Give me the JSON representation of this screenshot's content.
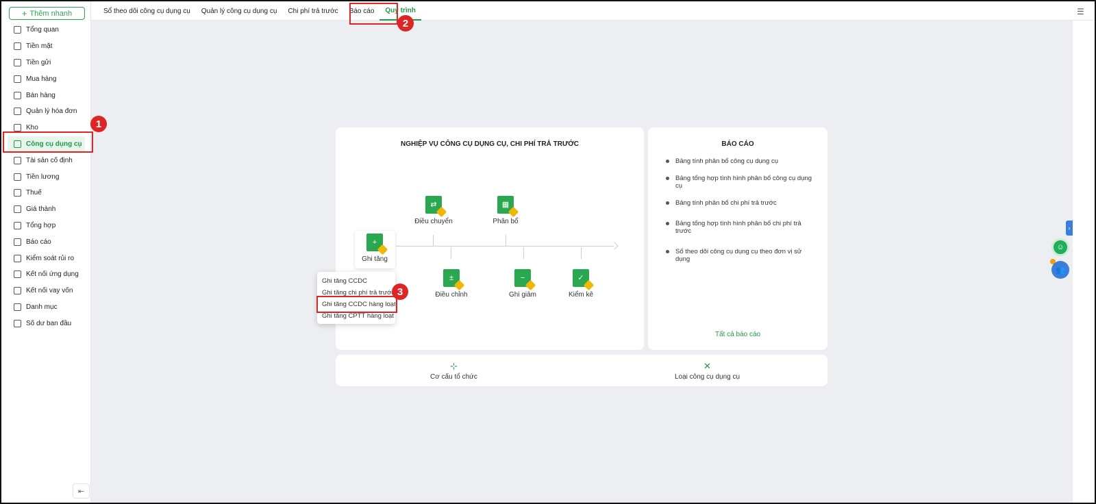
{
  "sidebar": {
    "add_button": "Thêm nhanh",
    "items": [
      {
        "label": "Tổng quan"
      },
      {
        "label": "Tiền mặt"
      },
      {
        "label": "Tiền gửi"
      },
      {
        "label": "Mua hàng"
      },
      {
        "label": "Bán hàng"
      },
      {
        "label": "Quản lý hóa đơn"
      },
      {
        "label": "Kho"
      },
      {
        "label": "Công cụ dụng cụ"
      },
      {
        "label": "Tài sản cố định"
      },
      {
        "label": "Tiền lương"
      },
      {
        "label": "Thuế"
      },
      {
        "label": "Giá thành"
      },
      {
        "label": "Tổng hợp"
      },
      {
        "label": "Báo cáo"
      },
      {
        "label": "Kiểm soát rủi ro"
      },
      {
        "label": "Kết nối ứng dụng"
      },
      {
        "label": "Kết nối vay vốn"
      },
      {
        "label": "Danh mục"
      },
      {
        "label": "Số dư ban đầu"
      }
    ],
    "collapse_icon": "collapse-left-icon"
  },
  "tabs": [
    {
      "label": "Sổ theo dõi công cụ dụng cụ"
    },
    {
      "label": "Quản lý công cụ dụng cụ"
    },
    {
      "label": "Chi phí trả trước"
    },
    {
      "label": "Báo cáo"
    },
    {
      "label": "Quy trình"
    }
  ],
  "process": {
    "title": "NGHIỆP VỤ CÔNG CỤ DỤNG CỤ, CHI PHÍ TRẢ TRƯỚC",
    "nodes": {
      "ghi_tang": "Ghi tăng",
      "dieu_chuyen": "Điều chuyển",
      "phan_bo": "Phân bổ",
      "dieu_chinh": "Điều chỉnh",
      "ghi_giam": "Ghi giảm",
      "kiem_ke": "Kiểm kê"
    },
    "dropdown": [
      "Ghi tăng CCDC",
      "Ghi tăng chi phí trả trước",
      "Ghi tăng CCDC hàng loạt",
      "Ghi tăng CPTT hàng loạt"
    ]
  },
  "report": {
    "title": "BÁO CÁO",
    "items": [
      "Bảng tính phân bổ công cụ dụng cụ",
      "Bảng tổng hợp tình hình phân bổ công cụ dụng cụ",
      "Bảng tính phân bổ chi phí trả trước",
      "Bảng tổng hợp tình hình phân bổ chi phí trả trước",
      "Sổ theo dõi công cụ dụng cụ theo đơn vị sử dụng"
    ],
    "all_link": "Tất cả báo cáo"
  },
  "bottom": {
    "org": "Cơ cấu tổ chức",
    "tool_type": "Loại công cụ dụng cụ"
  },
  "annotations": [
    "1",
    "2",
    "3"
  ],
  "colors": {
    "accent": "#1e9a46",
    "highlight": "#e02424",
    "background": "#eceef1"
  }
}
